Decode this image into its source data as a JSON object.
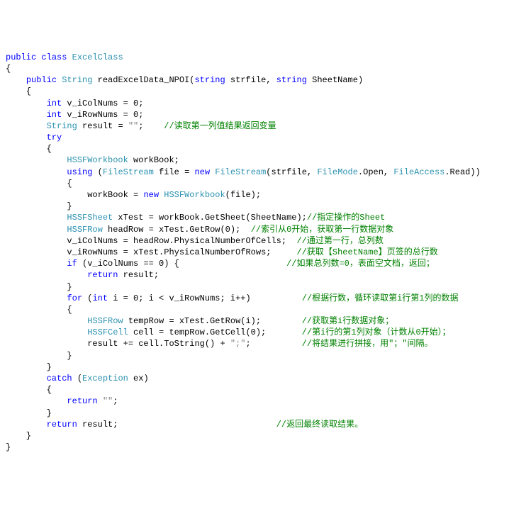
{
  "code": {
    "l01_kw1": "public",
    "l01_kw2": "class",
    "l01_type": "ExcelClass",
    "l02": "{",
    "l03_kw1": "public",
    "l03_type": "String",
    "l03_name": " readExcelData_NPOI(",
    "l03_kw2": "string",
    "l03_arg1": " strfile, ",
    "l03_kw3": "string",
    "l03_arg2": " SheetName)",
    "l04": "    {",
    "l05_kw": "int",
    "l05_rest": " v_iColNums = 0;",
    "l06_kw": "int",
    "l06_rest": " v_iRowNums = 0;",
    "l07_type": "String",
    "l07_rest": " result = ",
    "l07_str": "\"\"",
    "l07_semi": ";    ",
    "l07_cmt": "//读取第一列值结果返回变量",
    "l08_kw": "try",
    "l09": "        {",
    "l10_type": "HSSFWorkbook",
    "l10_rest": " workBook;",
    "l11_kw1": "using",
    "l11_p1": " (",
    "l11_type1": "FileStream",
    "l11_mid": " file = ",
    "l11_kw2": "new",
    "l11_sp": " ",
    "l11_type2": "FileStream",
    "l11_args": "(strfile, ",
    "l11_type3": "FileMode",
    "l11_open": ".Open, ",
    "l11_type4": "FileAccess",
    "l11_read": ".Read))",
    "l12": "            {",
    "l13_rest1": "                workBook = ",
    "l13_kw": "new",
    "l13_sp": " ",
    "l13_type": "HSSFWorkbook",
    "l13_rest2": "(file);",
    "l14": "            }",
    "l15_type": "HSSFSheet",
    "l15_rest": " xTest = workBook.GetSheet(SheetName);",
    "l15_cmt": "//指定操作的Sheet",
    "l16_type": "HSSFRow",
    "l16_rest": " headRow = xTest.GetRow(0);  ",
    "l16_cmt": "//索引从0开始，获取第一行数据对象",
    "l17_rest": "v_iColNums = headRow.PhysicalNumberOfCells;  ",
    "l17_cmt": "//通过第一行，总列数",
    "l18_rest": "v_iRowNums = xTest.PhysicalNumberOfRows;     ",
    "l18_cmt": "//获取【SheetName】页签的总行数",
    "l19_kw": "if",
    "l19_rest": " (v_iColNums == 0) {                     ",
    "l19_cmt": "//如果总列数=0，表面空文档，返回；",
    "l20_kw": "return",
    "l20_rest": " result;",
    "l21": "            }",
    "l22_kw": "for",
    "l22_p1": " (",
    "l22_kw2": "int",
    "l22_rest": " i = 0; i < v_iRowNums; i++)          ",
    "l22_cmt": "//根据行数，循环读取第i行第1列的数据",
    "l23": "            {",
    "l24_type": "HSSFRow",
    "l24_rest": " tempRow = xTest.GetRow(i);        ",
    "l24_cmt": "//获取第i行数据对象；",
    "l25_type": "HSSFCell",
    "l25_rest": " cell = tempRow.GetCell(0);       ",
    "l25_cmt": "//第i行的第1列对象（计数从0开始）；",
    "l26_rest": "result += cell.ToString() + ",
    "l26_str": "\";\"",
    "l26_semi": ";          ",
    "l26_cmt": "//将结果进行拼接，用\"；\"间隔。",
    "l27": "            }",
    "l28": "        }",
    "l29_kw": "catch",
    "l29_p1": " (",
    "l29_type": "Exception",
    "l29_rest": " ex)",
    "l30": "        {",
    "l31_kw": "return",
    "l31_sp": " ",
    "l31_str": "\"\"",
    "l31_semi": ";",
    "l32": "        }",
    "l33_kw": "return",
    "l33_rest": " result;                               ",
    "l33_cmt": "//返回最终读取结果。",
    "l34": "    }",
    "l35": "}"
  }
}
